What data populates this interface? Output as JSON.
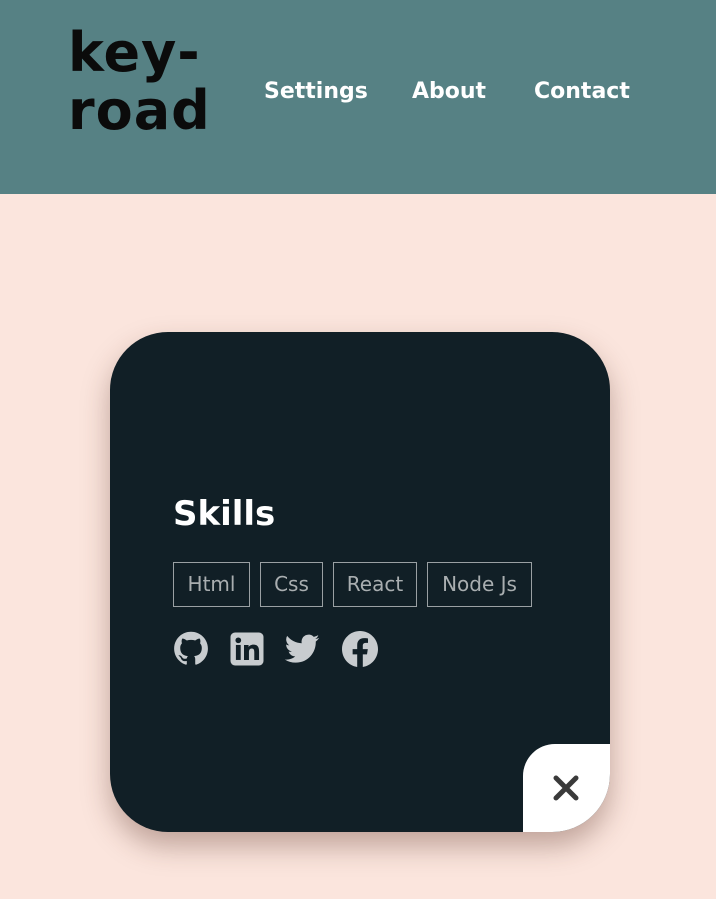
{
  "header": {
    "logo_line1": "key-",
    "logo_line2": "road",
    "nav": {
      "settings": "Settings",
      "about": "About",
      "contact": "Contact"
    }
  },
  "card": {
    "title": "Skills",
    "tags": [
      "Html",
      "Css",
      "React",
      "Node Js"
    ],
    "socials": [
      "github-icon",
      "linkedin-icon",
      "twitter-icon",
      "facebook-icon"
    ],
    "close_icon": "close-icon"
  },
  "colors": {
    "page_background": "#fbe5dd",
    "header_background": "#568184",
    "card_background": "#111f26",
    "tag_text": "#a9aeb0",
    "icon_color": "#c8cccf"
  }
}
